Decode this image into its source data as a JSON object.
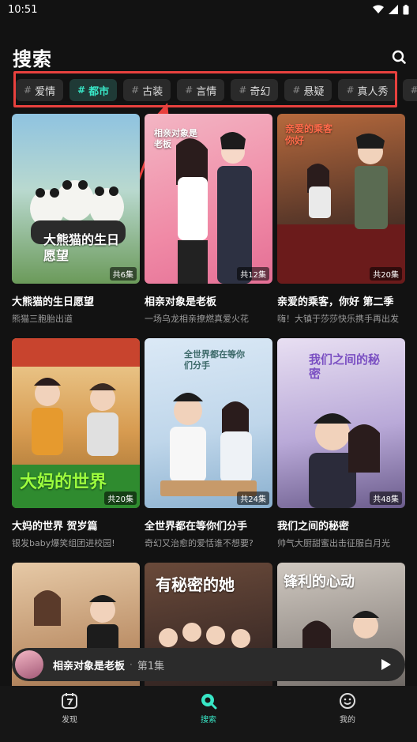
{
  "status": {
    "time": "10:51"
  },
  "header": {
    "title": "搜索",
    "search_icon": "search-icon"
  },
  "tags": [
    {
      "label": "爱情",
      "active": false
    },
    {
      "label": "都市",
      "active": true
    },
    {
      "label": "古装",
      "active": false
    },
    {
      "label": "言情",
      "active": false
    },
    {
      "label": "奇幻",
      "active": false
    },
    {
      "label": "悬疑",
      "active": false
    },
    {
      "label": "真人秀",
      "active": false
    }
  ],
  "dramas": [
    {
      "title": "大熊猫的生日愿望",
      "subtitle": "熊猫三胞胎出道",
      "episodes": "共6集",
      "poster_text": "大熊猫的生日愿望"
    },
    {
      "title": "相亲对象是老板",
      "subtitle": "一场乌龙相亲撩燃真爱火花",
      "episodes": "共12集",
      "poster_text": "相亲对象是老板"
    },
    {
      "title": "亲爱的乘客，你好 第二季",
      "subtitle": "嗨！大镇于莎莎快乐携手再出发",
      "episodes": "共20集",
      "poster_text": "亲爱的乘客你好"
    },
    {
      "title": "大妈的世界 贺岁篇",
      "subtitle": "银发baby爆笑组团进校园!",
      "episodes": "共20集",
      "poster_text": "大妈的世界"
    },
    {
      "title": "全世界都在等你们分手",
      "subtitle": "奇幻又治愈的爱恬谁不想要?",
      "episodes": "共24集",
      "poster_text": "全世界都在等你们分手"
    },
    {
      "title": "我们之间的秘密",
      "subtitle": "帅气大厨甜蜜出击征服白月光",
      "episodes": "共48集",
      "poster_text": "我们之间的秘密"
    },
    {
      "title": "",
      "subtitle": "",
      "episodes": "",
      "poster_text": ""
    },
    {
      "title": "",
      "subtitle": "",
      "episodes": "",
      "poster_text": "有秘密的她"
    },
    {
      "title": "",
      "subtitle": "",
      "episodes": "",
      "poster_text": "锋利的心动"
    }
  ],
  "mini_player": {
    "title": "相亲对象是老板",
    "separator": "·",
    "episode": "第1集"
  },
  "nav": [
    {
      "label": "发现",
      "icon": "discover-icon",
      "active": false
    },
    {
      "label": "搜索",
      "icon": "search-tab-icon",
      "active": true
    },
    {
      "label": "我的",
      "icon": "profile-icon",
      "active": false
    }
  ],
  "colors": {
    "accent": "#38e6c6",
    "annotation": "#e8413e",
    "background": "#121212"
  }
}
